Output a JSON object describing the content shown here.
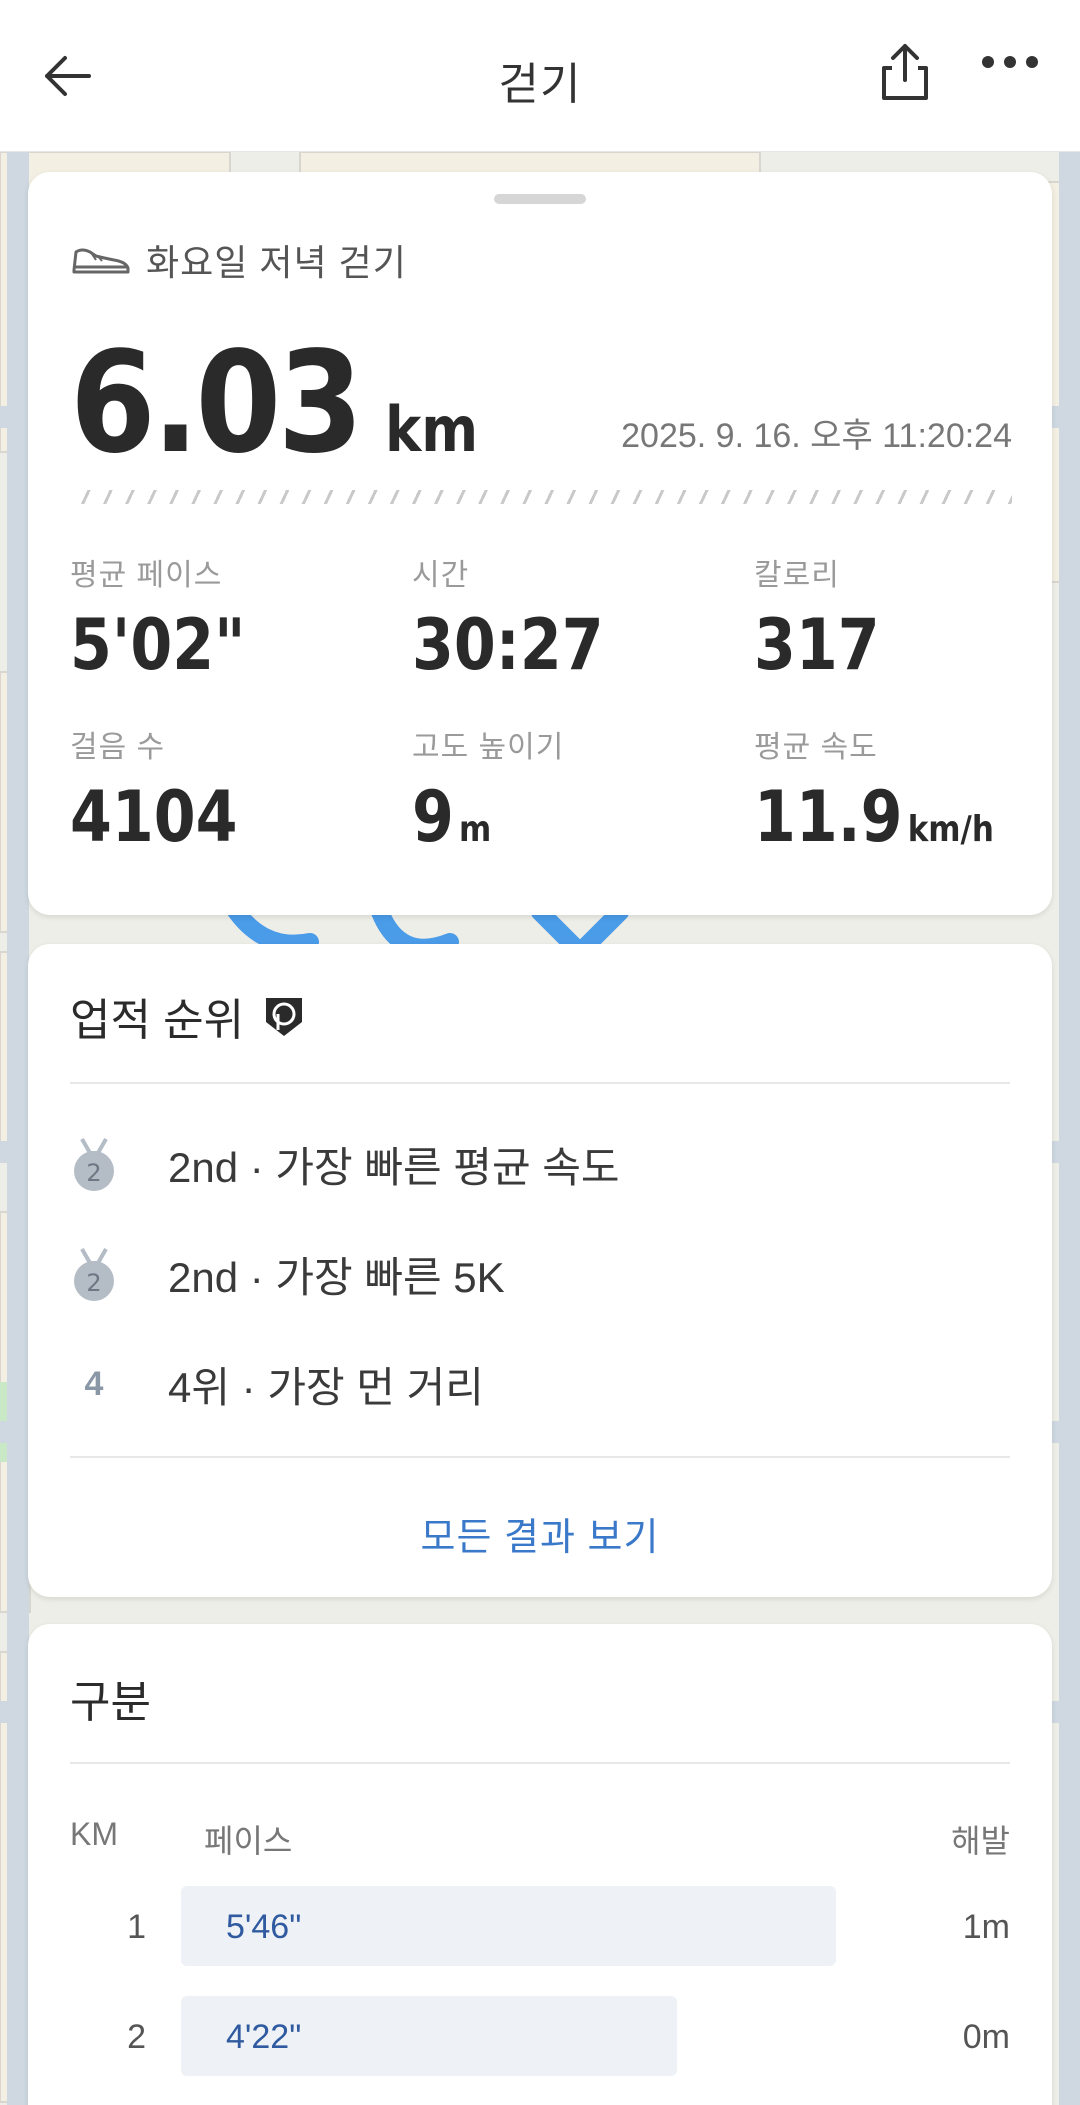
{
  "header": {
    "title": "걷기"
  },
  "summary": {
    "activity_name": "화요일 저녁 걷기",
    "distance_value": "6.03",
    "distance_unit": "km",
    "datetime": "2025. 9. 16. 오후 11:20:24",
    "stats": [
      {
        "label": "평균 페이스",
        "value": "5'02\"",
        "unit": ""
      },
      {
        "label": "시간",
        "value": "30:27",
        "unit": ""
      },
      {
        "label": "칼로리",
        "value": "317",
        "unit": ""
      },
      {
        "label": "걸음 수",
        "value": "4104",
        "unit": ""
      },
      {
        "label": "고도 높이기",
        "value": "9",
        "unit": "m"
      },
      {
        "label": "평균 속도",
        "value": "11.9",
        "unit": "km/h"
      }
    ]
  },
  "achievements": {
    "title": "업적 순위",
    "items": [
      {
        "rank_badge": "2",
        "text": "2nd · 가장 빠른 평균 속도"
      },
      {
        "rank_badge": "2",
        "text": "2nd · 가장 빠른 5K"
      },
      {
        "rank_badge": "4",
        "text": "4위 · 가장 먼 거리"
      }
    ],
    "see_all": "모든 결과 보기"
  },
  "splits": {
    "title": "구분",
    "col_km": "KM",
    "col_pace": "페이스",
    "col_elev": "해발",
    "rows": [
      {
        "km": "1",
        "pace": "5'46\"",
        "elev": "1m",
        "pace_fraction": 1.0
      },
      {
        "km": "2",
        "pace": "4'22\"",
        "elev": "0m",
        "pace_fraction": 0.757
      }
    ]
  },
  "colors": {
    "accent_blue": "#3a78c9",
    "route_blue": "#4a9be8",
    "medal_silver": "#b4bcc6"
  }
}
